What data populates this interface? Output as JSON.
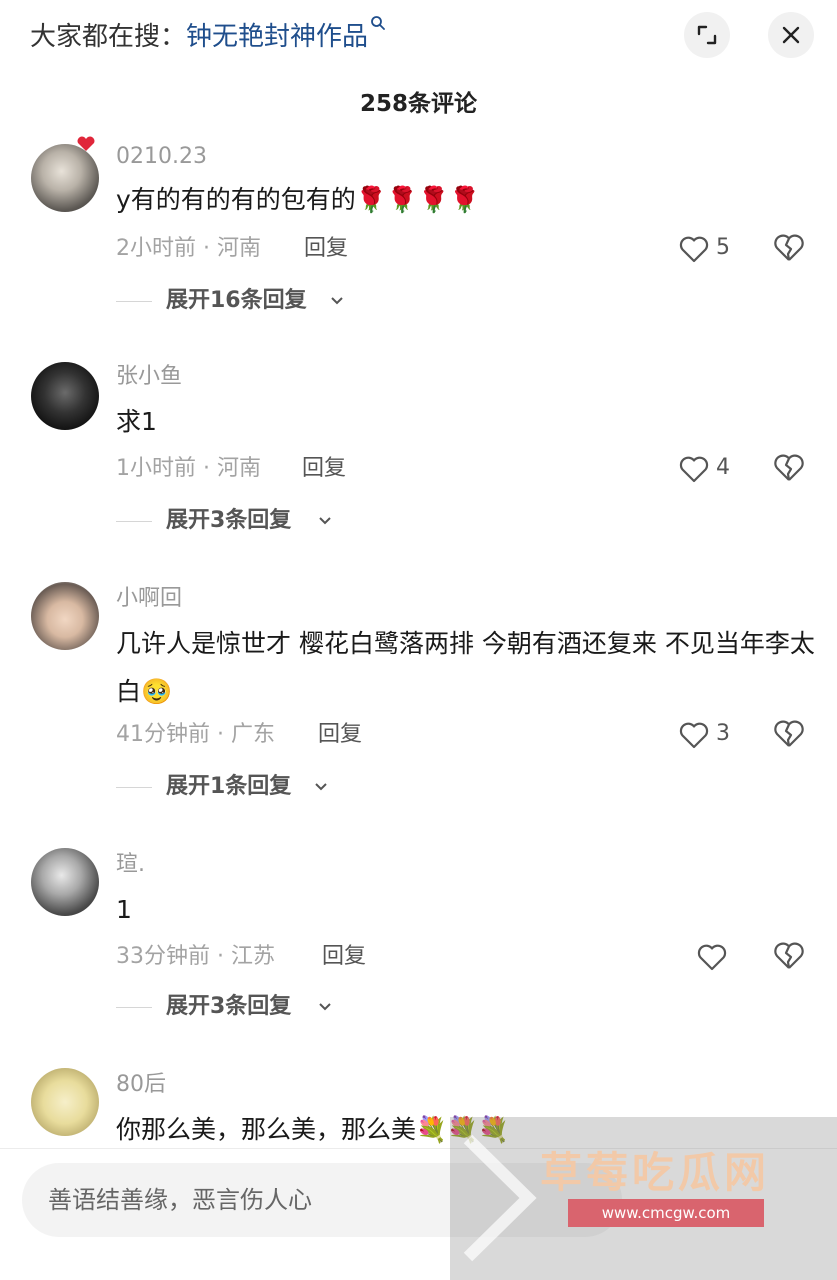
{
  "header": {
    "search_prefix": "大家都在搜：",
    "search_keyword": "钟无艳封神作品",
    "comment_count_label": "258条评论"
  },
  "comments": [
    {
      "username": "0210.23",
      "text": "y有的有的有的包有的🌹🌹🌹🌹",
      "meta": "2小时前 · 河南",
      "reply_label": "回复",
      "likes": "5",
      "expand_label": "展开16条回复"
    },
    {
      "username": "张小鱼",
      "text": "求1",
      "meta": "1小时前 · 河南",
      "reply_label": "回复",
      "likes": "4",
      "expand_label": "展开3条回复"
    },
    {
      "username": "小啊回",
      "text": "几许人是惊世才 樱花白鹭落两排 今朝有酒还复来 不见当年李太白🥹",
      "meta": "41分钟前 · 广东",
      "reply_label": "回复",
      "likes": "3",
      "expand_label": "展开1条回复"
    },
    {
      "username": "瑄.",
      "text": "1",
      "meta": "33分钟前 · 江苏",
      "reply_label": "回复",
      "likes": "",
      "expand_label": "展开3条回复"
    },
    {
      "username": "80后",
      "text": "你那么美，那么美，那么美💐💐💐"
    }
  ],
  "input": {
    "placeholder": "善语结善缘，恶言伤人心"
  },
  "watermark": {
    "title": "草莓吃瓜网",
    "url": "www.cmcgw.com"
  },
  "colors": {
    "keyword": "#1f4e8c",
    "username": "#999999",
    "meta": "#a3a3a3",
    "background": "#ffffff"
  }
}
